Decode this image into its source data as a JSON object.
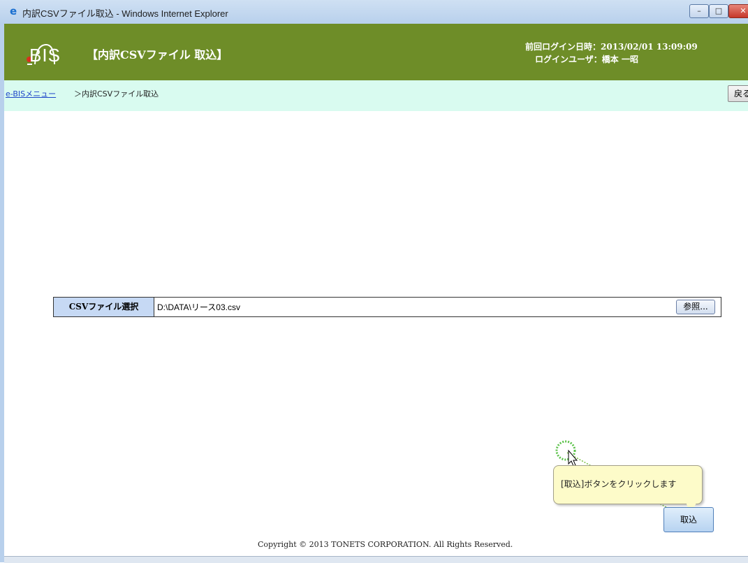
{
  "window": {
    "title": "内訳CSVファイル取込 - Windows Internet Explorer",
    "controls": {
      "minimize": "–",
      "maximize": "□",
      "close": "✕"
    }
  },
  "header": {
    "logo_text": "BIS",
    "page_heading": "【内訳CSVファイル 取込】",
    "last_login": "前回ログイン日時：2013/02/01 13:09:09",
    "login_user": "ログインユーザ：橋本 一昭"
  },
  "breadcrumb": {
    "link_label": "e-BISメニュー",
    "current": "＞内訳CSVファイル取込",
    "back_label": "戻る"
  },
  "file_select": {
    "label": "CSVファイル選択",
    "value": "D:\\DATA\\リース03.csv",
    "browse_label": "参照..."
  },
  "tutorial": {
    "tooltip_text": "[取込]ボタンをクリックします",
    "import_label": "取込"
  },
  "footer": {
    "copyright": "Copyright © 2013 TONETS CORPORATION. All Rights Reserved."
  },
  "colors": {
    "header_bg": "#6e8d28",
    "breadcrumb_bg": "#d9fbf0",
    "label_bg": "#c6d9f4",
    "tooltip_bg": "#fdfbc9"
  }
}
